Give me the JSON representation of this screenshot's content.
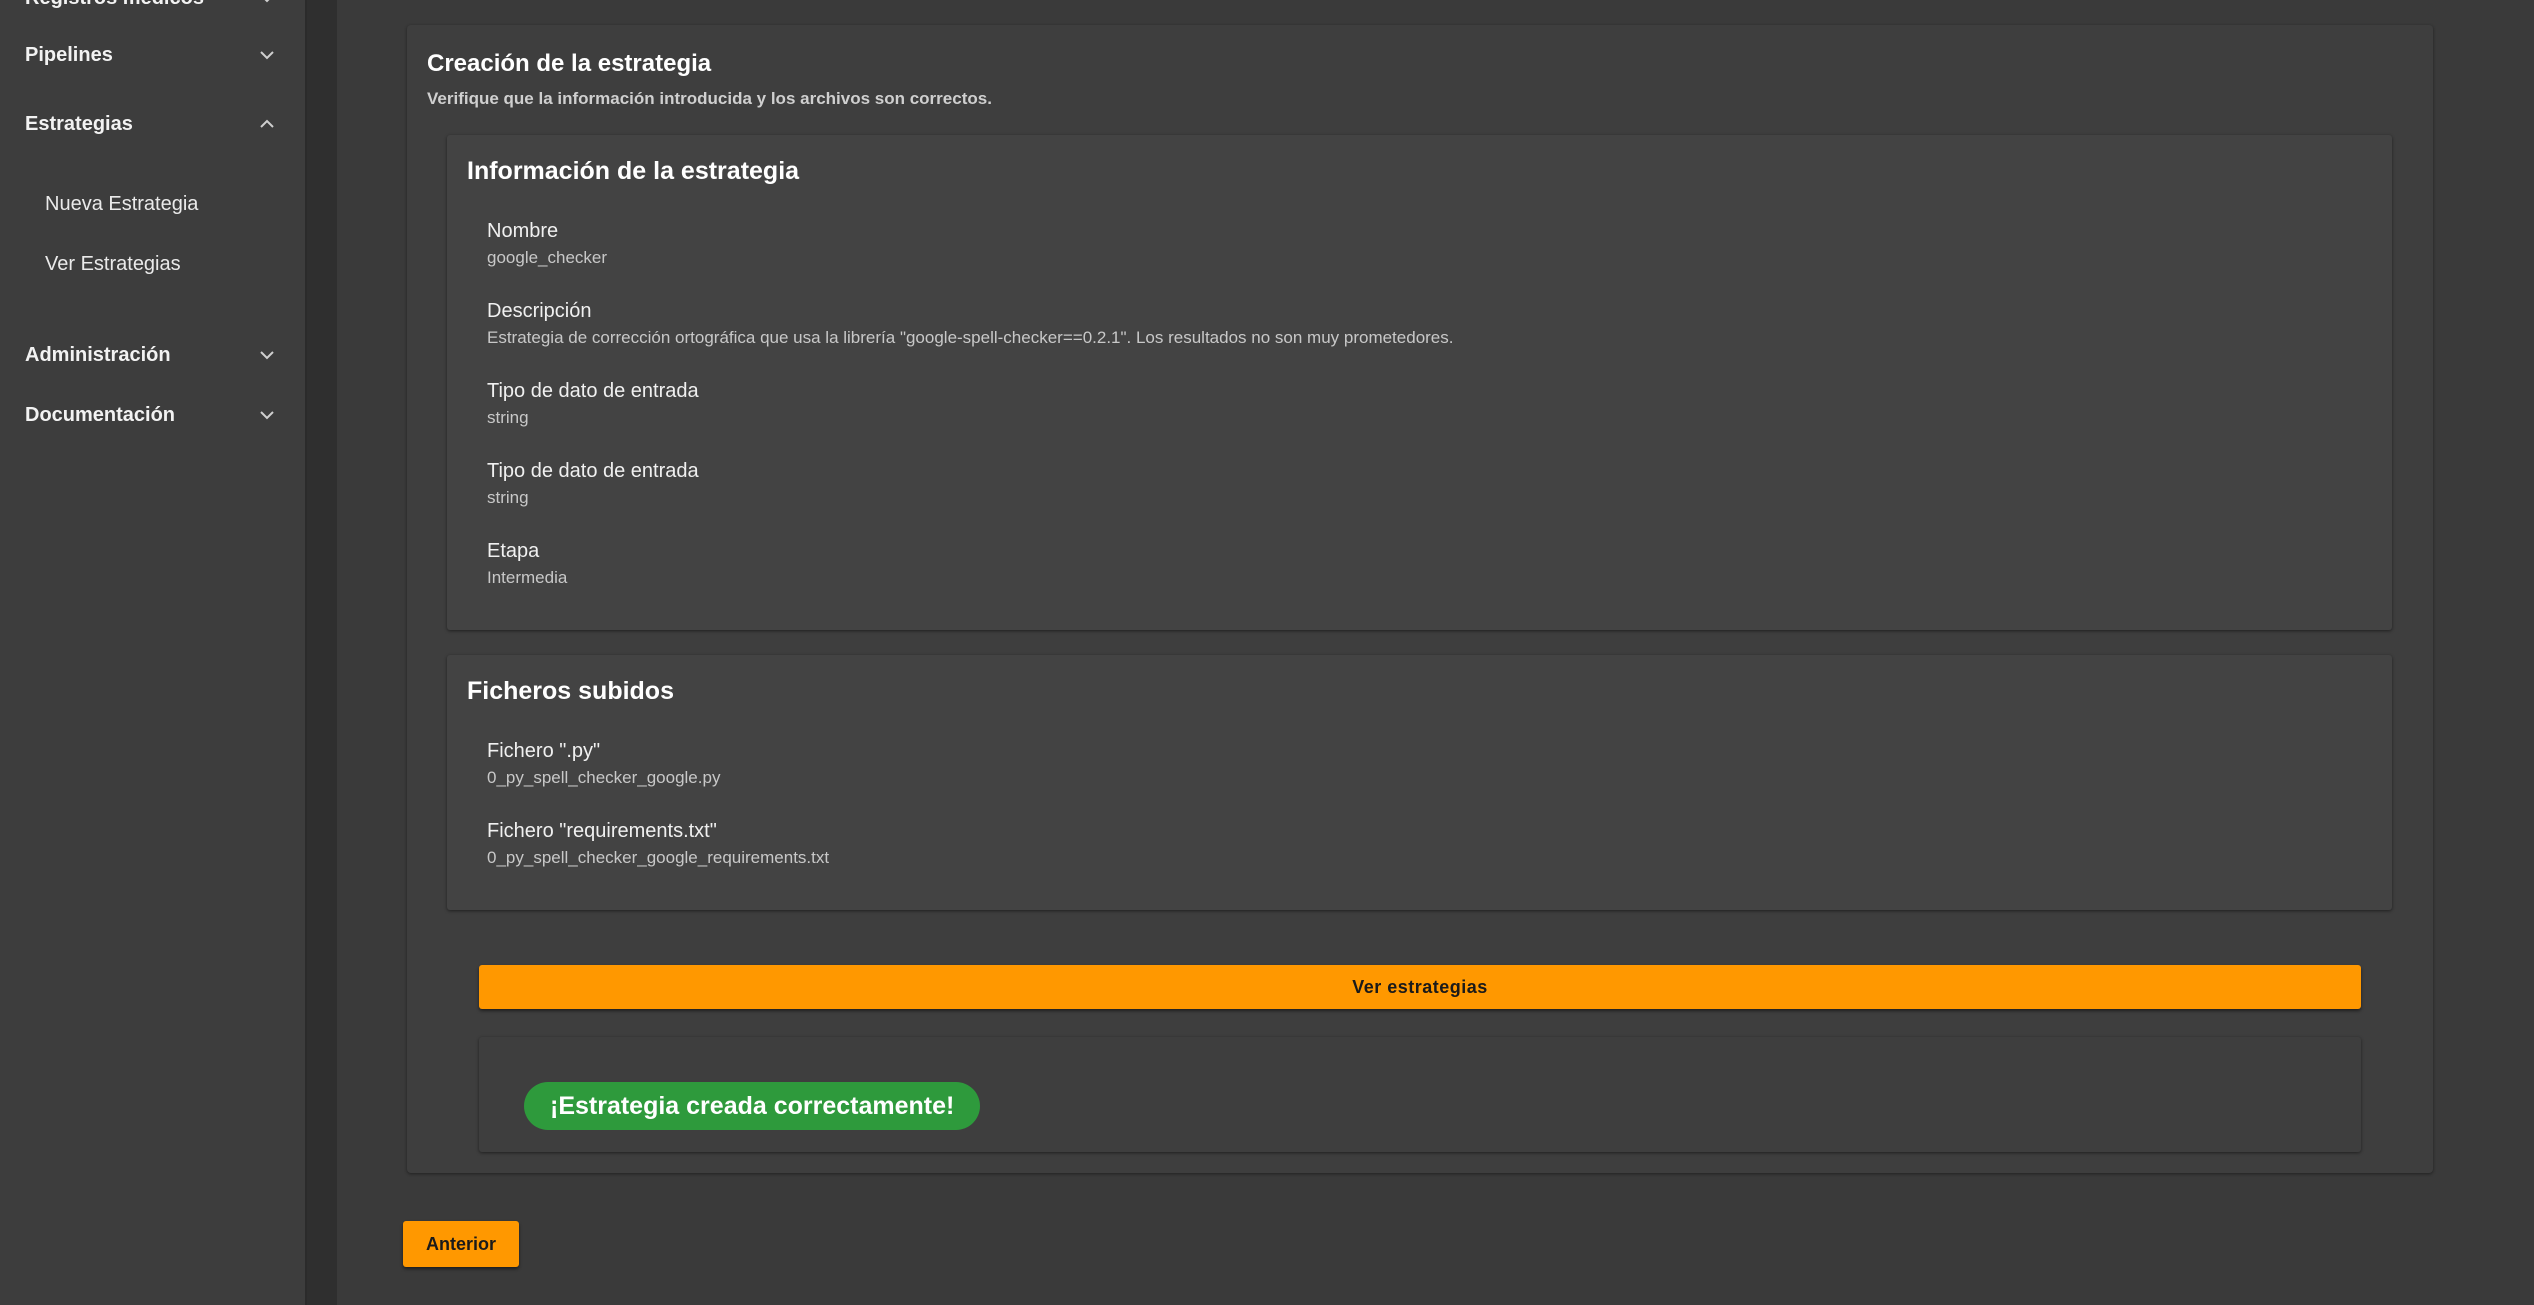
{
  "sidebar": {
    "cut_item": {
      "label": "Registros médicos"
    },
    "items": [
      {
        "label": "Pipelines",
        "icon": "chevron-down-icon"
      },
      {
        "label": "Estrategias",
        "icon": "chevron-up-icon"
      },
      {
        "label": "Administración",
        "icon": "chevron-down-icon"
      },
      {
        "label": "Documentación",
        "icon": "chevron-down-icon"
      }
    ],
    "sub_items": [
      {
        "label": "Nueva Estrategia"
      },
      {
        "label": "Ver Estrategias"
      }
    ]
  },
  "main": {
    "card": {
      "title": "Creación de la estrategia",
      "subtitle": "Verifique que la información introducida y los archivos son correctos."
    },
    "info_panel": {
      "title": "Información de la estrategia",
      "fields": [
        {
          "label": "Nombre",
          "value": "google_checker"
        },
        {
          "label": "Descripción",
          "value": "Estrategia de corrección ortográfica que usa la librería \"google-spell-checker==0.2.1\". Los resultados no son muy prometedores."
        },
        {
          "label": "Tipo de dato de entrada",
          "value": "string"
        },
        {
          "label": "Tipo de dato de entrada",
          "value": "string"
        },
        {
          "label": "Etapa",
          "value": "Intermedia"
        }
      ]
    },
    "files_panel": {
      "title": "Ficheros subidos",
      "fields": [
        {
          "label": "Fichero \".py\"",
          "value": "0_py_spell_checker_google.py"
        },
        {
          "label": "Fichero \"requirements.txt\"",
          "value": "0_py_spell_checker_google_requirements.txt"
        }
      ]
    },
    "view_button": {
      "label": "Ver estrategias"
    },
    "success_message": "¡Estrategia creada correctamente!",
    "back_button": {
      "label": "Anterior"
    }
  },
  "colors": {
    "accent": "#ff9800",
    "success": "#2e9a3c",
    "background": "#3a3a3a",
    "sidebar": "#3d3d3d"
  }
}
